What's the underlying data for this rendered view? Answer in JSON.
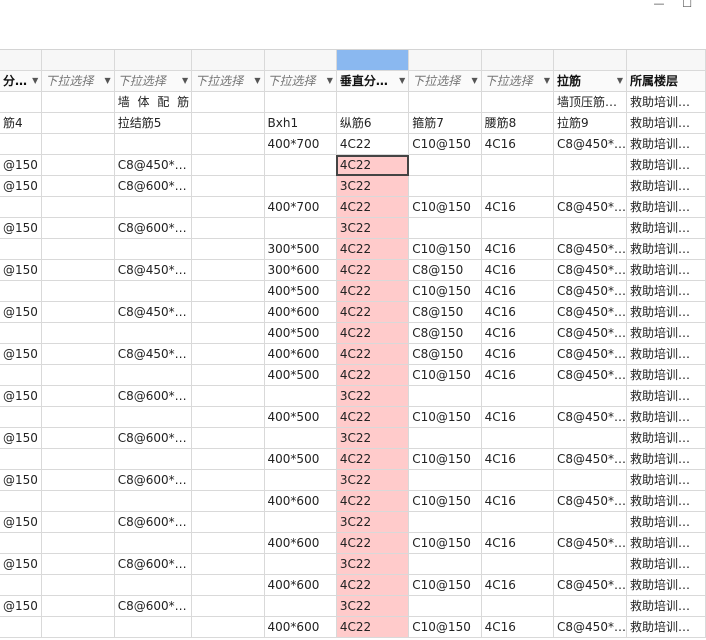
{
  "window": {
    "minimize_glyph": "—",
    "close_glyph": "☐"
  },
  "header": [
    "分…",
    "下拉选择",
    "下拉选择",
    "下拉选择",
    "下拉选择",
    "垂直分…",
    "下拉选择",
    "下拉选择",
    "拉筋",
    "所属楼层"
  ],
  "group_row": [
    "",
    "",
    "墙 体 配 筋",
    "",
    "",
    "",
    "",
    "",
    "墙顶压筋…",
    "救助培训…"
  ],
  "column_row": [
    "筋4",
    "",
    "拉结筋5",
    "",
    "Bxh1",
    "纵筋6",
    "箍筋7",
    "腰筋8",
    "拉筋9",
    "救助培训…"
  ],
  "rows": [
    [
      "",
      "",
      "",
      "",
      "400*700",
      "4C22",
      "C10@150",
      "4C16",
      "C8@450*…",
      "救助培训…"
    ],
    [
      "@150",
      "",
      "C8@450*…",
      "",
      "",
      "4C22",
      "",
      "",
      "",
      "救助培训…"
    ],
    [
      "@150",
      "",
      "C8@600*…",
      "",
      "",
      "3C22",
      "",
      "",
      "",
      "救助培训…"
    ],
    [
      "",
      "",
      "",
      "",
      "400*700",
      "4C22",
      "C10@150",
      "4C16",
      "C8@450*…",
      "救助培训…"
    ],
    [
      "@150",
      "",
      "C8@600*…",
      "",
      "",
      "3C22",
      "",
      "",
      "",
      "救助培训…"
    ],
    [
      "",
      "",
      "",
      "",
      "300*500",
      "4C22",
      "C10@150",
      "4C16",
      "C8@450*…",
      "救助培训…"
    ],
    [
      "@150",
      "",
      "C8@450*…",
      "",
      "300*600",
      "4C22",
      "C8@150",
      "4C16",
      "C8@450*…",
      "救助培训…"
    ],
    [
      "",
      "",
      "",
      "",
      "400*500",
      "4C22",
      "C10@150",
      "4C16",
      "C8@450*…",
      "救助培训…"
    ],
    [
      "@150",
      "",
      "C8@450*…",
      "",
      "400*600",
      "4C22",
      "C8@150",
      "4C16",
      "C8@450*…",
      "救助培训…"
    ],
    [
      "",
      "",
      "",
      "",
      "400*500",
      "4C22",
      "C8@150",
      "4C16",
      "C8@450*…",
      "救助培训…"
    ],
    [
      "@150",
      "",
      "C8@450*…",
      "",
      "400*600",
      "4C22",
      "C8@150",
      "4C16",
      "C8@450*…",
      "救助培训…"
    ],
    [
      "",
      "",
      "",
      "",
      "400*500",
      "4C22",
      "C10@150",
      "4C16",
      "C8@450*…",
      "救助培训…"
    ],
    [
      "@150",
      "",
      "C8@600*…",
      "",
      "",
      "3C22",
      "",
      "",
      "",
      "救助培训…"
    ],
    [
      "",
      "",
      "",
      "",
      "400*500",
      "4C22",
      "C10@150",
      "4C16",
      "C8@450*…",
      "救助培训…"
    ],
    [
      "@150",
      "",
      "C8@600*…",
      "",
      "",
      "3C22",
      "",
      "",
      "",
      "救助培训…"
    ],
    [
      "",
      "",
      "",
      "",
      "400*500",
      "4C22",
      "C10@150",
      "4C16",
      "C8@450*…",
      "救助培训…"
    ],
    [
      "@150",
      "",
      "C8@600*…",
      "",
      "",
      "3C22",
      "",
      "",
      "",
      "救助培训…"
    ],
    [
      "",
      "",
      "",
      "",
      "400*600",
      "4C22",
      "C10@150",
      "4C16",
      "C8@450*…",
      "救助培训…"
    ],
    [
      "@150",
      "",
      "C8@600*…",
      "",
      "",
      "3C22",
      "",
      "",
      "",
      "救助培训…"
    ],
    [
      "",
      "",
      "",
      "",
      "400*600",
      "4C22",
      "C10@150",
      "4C16",
      "C8@450*…",
      "救助培训…"
    ],
    [
      "@150",
      "",
      "C8@600*…",
      "",
      "",
      "3C22",
      "",
      "",
      "",
      "救助培训…"
    ],
    [
      "",
      "",
      "",
      "",
      "400*600",
      "4C22",
      "C10@150",
      "4C16",
      "C8@450*…",
      "救助培训…"
    ],
    [
      "@150",
      "",
      "C8@600*…",
      "",
      "",
      "3C22",
      "",
      "",
      "",
      "救助培训…"
    ],
    [
      "",
      "",
      "",
      "",
      "400*600",
      "4C22",
      "C10@150",
      "4C16",
      "C8@450*…",
      "救助培训…"
    ]
  ]
}
